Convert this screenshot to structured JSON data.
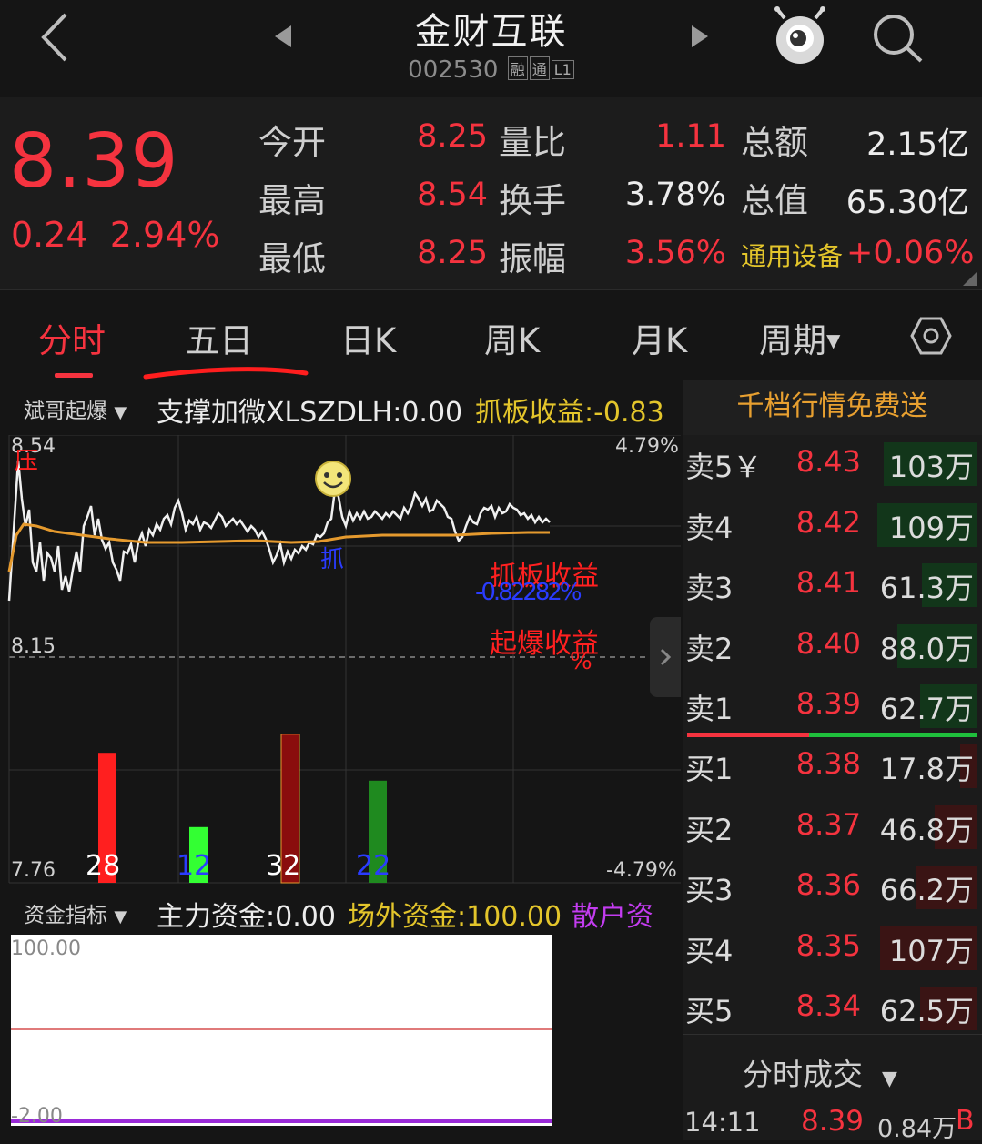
{
  "header": {
    "back_icon": "chevron-left-icon",
    "prev_icon": "triangle-left-icon",
    "next_icon": "triangle-right-icon",
    "title": "金财互联",
    "code": "002530",
    "tags": [
      "融",
      "通",
      "L1"
    ],
    "mascot_icon": "eye-mascot-icon",
    "search_icon": "search-icon"
  },
  "quote": {
    "price": "8.39",
    "change": "0.24",
    "change_pct": "2.94%",
    "col1": [
      {
        "label": "今开",
        "value": "8.25"
      },
      {
        "label": "最高",
        "value": "8.54"
      },
      {
        "label": "最低",
        "value": "8.25"
      }
    ],
    "col2": [
      {
        "label": "量比",
        "value": "1.11"
      },
      {
        "label": "换手",
        "value": "3.78%"
      },
      {
        "label": "振幅",
        "value": "3.56%"
      }
    ],
    "col3": [
      {
        "label": "总额",
        "value": "2.15亿"
      },
      {
        "label": "总值",
        "value": "65.30亿"
      },
      {
        "label": "通用设备",
        "value": "+0.06%"
      }
    ]
  },
  "tabs": {
    "items": [
      "分时",
      "五日",
      "日K",
      "周K",
      "月K",
      "周期"
    ],
    "active": "分时",
    "settings_icon": "hexagon-settings-icon"
  },
  "chart": {
    "indicator_name": "斌哥起爆",
    "support_label": "支撑加微XLSZDLH:",
    "support_value": "0.00",
    "grab_label": "抓板收益:",
    "grab_value": "-0.83",
    "price_high": "8.54",
    "price_mid": "8.15",
    "price_low": "7.76",
    "pct_high": "4.79%",
    "pct_low": "-4.79%",
    "mark_ya": "压",
    "mark_zhua": "抓",
    "ann_grab": "抓板收益",
    "ann_grab_val": "-0.82282%",
    "ann_boom": "起爆收益",
    "ann_boom_val": "%",
    "bars": [
      {
        "label": "28",
        "value": 28,
        "color": "#ff1f1f"
      },
      {
        "label": "12",
        "value": 12,
        "color": "#33ff33"
      },
      {
        "label": "32",
        "value": 32,
        "color": "#8a0d0d"
      },
      {
        "label": "22",
        "value": 22,
        "color": "#1f8a1f"
      }
    ]
  },
  "fund": {
    "indicator_name": "资金指标",
    "main_label": "主力资金:",
    "main_value": "0.00",
    "outside_label": "场外资金:",
    "outside_value": "100.00",
    "retail_label": "散户资",
    "top": "100.00",
    "bottom": "-2.00"
  },
  "order_book": {
    "promo": "千档行情免费送",
    "asks": [
      {
        "label": "卖5￥",
        "price": "8.43",
        "vol": "103万",
        "fill": 0.91
      },
      {
        "label": "卖4",
        "price": "8.42",
        "vol": "109万",
        "fill": 0.97
      },
      {
        "label": "卖3",
        "price": "8.41",
        "vol": "61.3万",
        "fill": 0.54
      },
      {
        "label": "卖2",
        "price": "8.40",
        "vol": "88.0万",
        "fill": 0.78
      },
      {
        "label": "卖1",
        "price": "8.39",
        "vol": "62.7万",
        "fill": 0.55
      }
    ],
    "bids": [
      {
        "label": "买1",
        "price": "8.38",
        "vol": "17.8万",
        "fill": 0.16
      },
      {
        "label": "买2",
        "price": "8.37",
        "vol": "46.8万",
        "fill": 0.41
      },
      {
        "label": "买3",
        "price": "8.36",
        "vol": "66.2万",
        "fill": 0.59
      },
      {
        "label": "买4",
        "price": "8.35",
        "vol": "107万",
        "fill": 0.95
      },
      {
        "label": "买5",
        "price": "8.34",
        "vol": "62.5万",
        "fill": 0.55
      }
    ],
    "trade_header": "分时成交",
    "trade": {
      "time": "14:11",
      "price": "8.39",
      "vol": "0.84万",
      "side": "B"
    }
  },
  "colors": {
    "up": "#f5333f",
    "down": "#1fbf3c",
    "accent_yellow": "#e3c52b",
    "avg_line": "#e59a2e"
  }
}
